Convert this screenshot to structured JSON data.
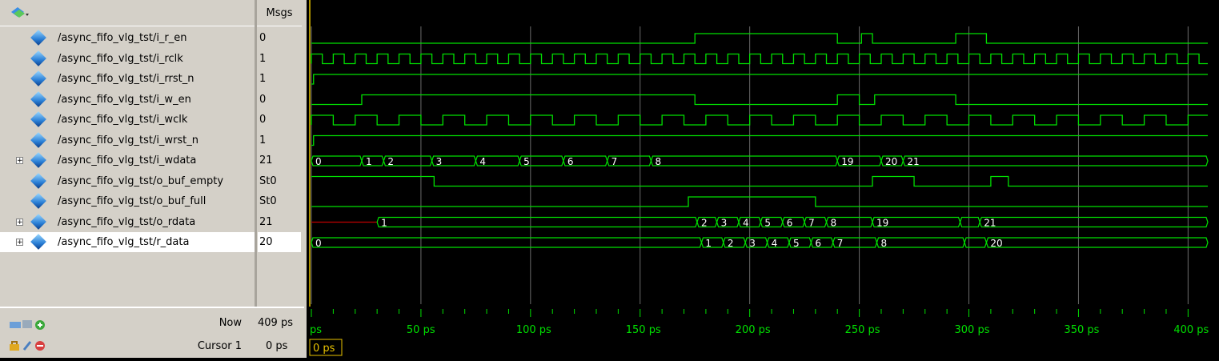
{
  "header": {
    "msgs_label": "Msgs"
  },
  "signals": [
    {
      "name": "/async_fifo_vlg_tst/i_r_en",
      "value": "0",
      "expandable": false
    },
    {
      "name": "/async_fifo_vlg_tst/i_rclk",
      "value": "1",
      "expandable": false
    },
    {
      "name": "/async_fifo_vlg_tst/i_rrst_n",
      "value": "1",
      "expandable": false
    },
    {
      "name": "/async_fifo_vlg_tst/i_w_en",
      "value": "0",
      "expandable": false
    },
    {
      "name": "/async_fifo_vlg_tst/i_wclk",
      "value": "0",
      "expandable": false
    },
    {
      "name": "/async_fifo_vlg_tst/i_wrst_n",
      "value": "1",
      "expandable": false
    },
    {
      "name": "/async_fifo_vlg_tst/i_wdata",
      "value": "21",
      "expandable": true
    },
    {
      "name": "/async_fifo_vlg_tst/o_buf_empty",
      "value": "St0",
      "expandable": false
    },
    {
      "name": "/async_fifo_vlg_tst/o_buf_full",
      "value": "St0",
      "expandable": false
    },
    {
      "name": "/async_fifo_vlg_tst/o_rdata",
      "value": "21",
      "expandable": true
    },
    {
      "name": "/async_fifo_vlg_tst/r_data",
      "value": "20",
      "expandable": true
    }
  ],
  "footer": {
    "now_label": "Now",
    "now_value": "409 ps",
    "cursor_label": "Cursor 1",
    "cursor_value": "0 ps",
    "cursor_marker": "0 ps"
  },
  "timeline": {
    "ticks": [
      "ps",
      "50 ps",
      "100 ps",
      "150 ps",
      "200 ps",
      "250 ps",
      "300 ps",
      "350 ps",
      "400 ps"
    ],
    "range_ps": [
      0,
      409
    ]
  },
  "waves": {
    "i_r_en": [
      [
        0,
        0
      ],
      [
        175,
        1
      ],
      [
        240,
        0
      ],
      [
        251,
        1
      ],
      [
        256,
        0
      ],
      [
        294,
        1
      ],
      [
        308,
        0
      ]
    ],
    "i_rclk_period_ps": 10,
    "i_rrst_n": [
      [
        0,
        0
      ],
      [
        1,
        1
      ]
    ],
    "i_w_en": [
      [
        0,
        0
      ],
      [
        23,
        1
      ],
      [
        175,
        0
      ],
      [
        240,
        1
      ],
      [
        250,
        0
      ],
      [
        257,
        1
      ],
      [
        294,
        0
      ]
    ],
    "i_wclk_period_ps": 20,
    "i_wrst_n": [
      [
        0,
        0
      ],
      [
        1,
        1
      ]
    ],
    "i_wdata": [
      [
        0,
        "0"
      ],
      [
        23,
        "1"
      ],
      [
        33,
        "2"
      ],
      [
        55,
        "3"
      ],
      [
        75,
        "4"
      ],
      [
        95,
        "5"
      ],
      [
        115,
        "6"
      ],
      [
        135,
        "7"
      ],
      [
        155,
        "8"
      ],
      [
        240,
        "19"
      ],
      [
        260,
        "20"
      ],
      [
        270,
        "21"
      ]
    ],
    "o_buf_empty": [
      [
        0,
        1
      ],
      [
        56,
        0
      ],
      [
        256,
        1
      ],
      [
        275,
        0
      ],
      [
        310,
        1
      ],
      [
        318,
        0
      ]
    ],
    "o_buf_full": [
      [
        0,
        0
      ],
      [
        172,
        1
      ],
      [
        230,
        0
      ]
    ],
    "o_rdata": [
      [
        0,
        "X"
      ],
      [
        30,
        "1"
      ],
      [
        176,
        "2"
      ],
      [
        185,
        "3"
      ],
      [
        195,
        "4"
      ],
      [
        205,
        "5"
      ],
      [
        215,
        "6"
      ],
      [
        225,
        "7"
      ],
      [
        235,
        "8"
      ],
      [
        256,
        "19"
      ],
      [
        296,
        ""
      ],
      [
        305,
        "21"
      ]
    ],
    "r_data": [
      [
        0,
        "0"
      ],
      [
        178,
        "1"
      ],
      [
        188,
        "2"
      ],
      [
        198,
        "3"
      ],
      [
        208,
        "4"
      ],
      [
        218,
        "5"
      ],
      [
        228,
        "6"
      ],
      [
        238,
        "7"
      ],
      [
        258,
        "8"
      ],
      [
        298,
        ""
      ],
      [
        308,
        "20"
      ]
    ]
  },
  "colors": {
    "wave": "#00e000",
    "grid": "#6a6a6a",
    "cursor": "#e8c200",
    "background": "#000000"
  }
}
